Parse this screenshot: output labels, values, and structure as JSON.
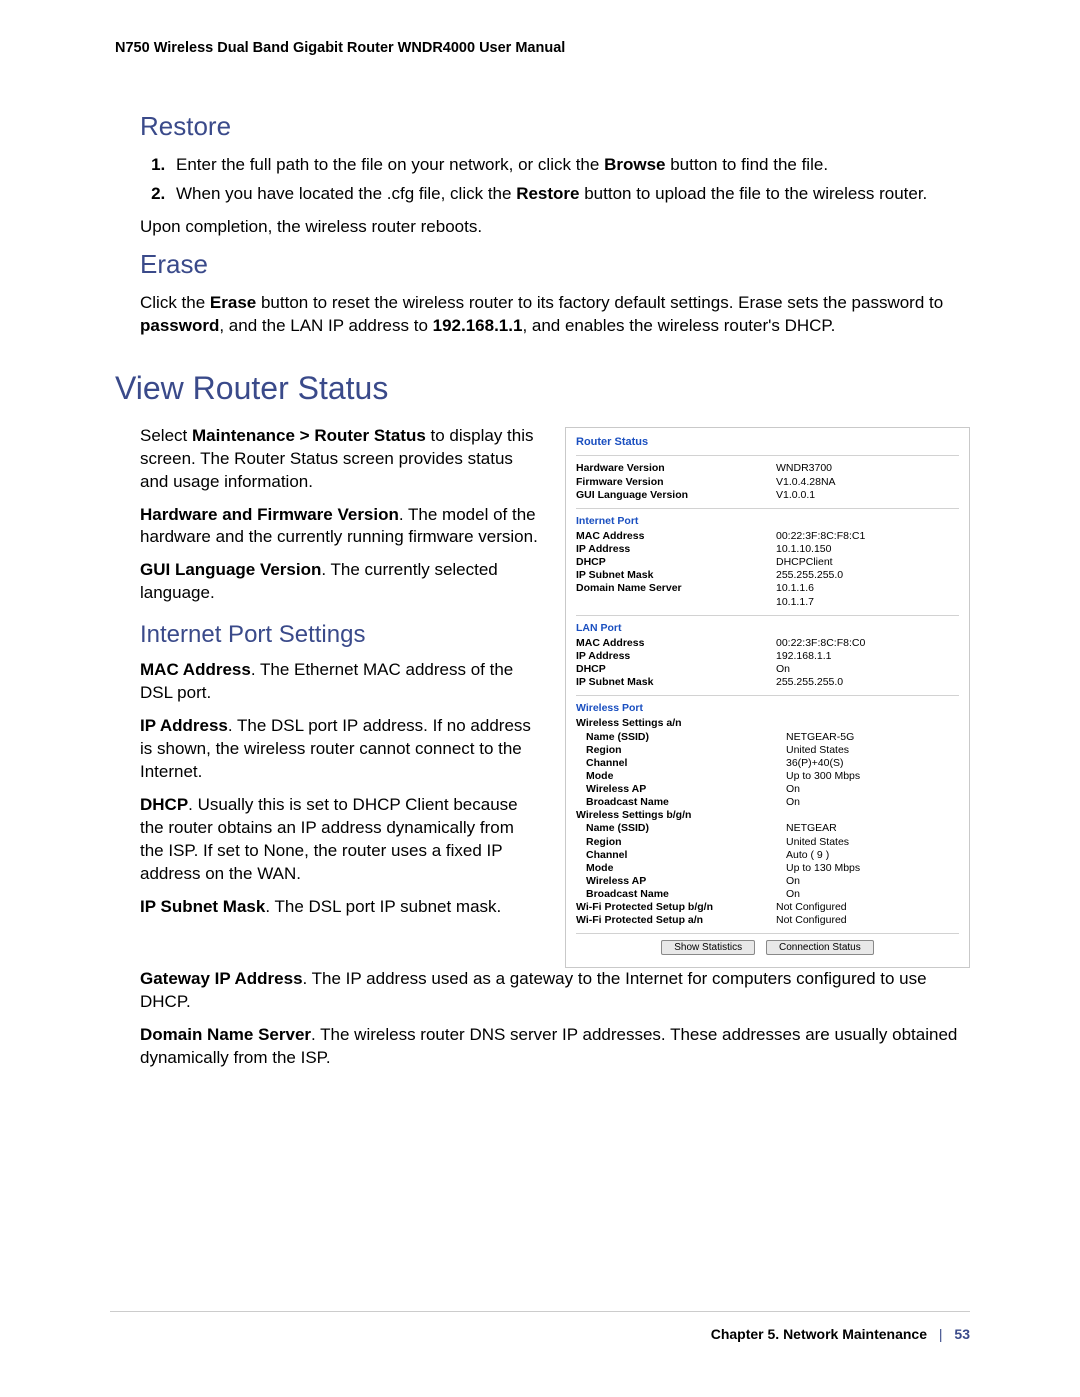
{
  "header": "N750 Wireless Dual Band Gigabit Router WNDR4000 User Manual",
  "restore": {
    "title": "Restore",
    "step1_a": "Enter the full path to the file on your network, or click the ",
    "step1_b": "Browse",
    "step1_c": " button to find the file.",
    "step2_a": "When you have located the .cfg file, click the ",
    "step2_b": "Restore",
    "step2_c": " button to upload the file to the wireless router.",
    "after": "Upon completion, the wireless router reboots."
  },
  "erase": {
    "title": "Erase",
    "p1_a": "Click the ",
    "p1_b": "Erase",
    "p1_c": " button to reset the wireless router to its factory default settings. Erase sets the password to ",
    "p1_d": "password",
    "p1_e": ", and the LAN IP address to ",
    "p1_f": "192.168.1.1",
    "p1_g": ", and enables the wireless router's DHCP."
  },
  "view": {
    "title": "View Router Status",
    "p1_a": "Select ",
    "p1_b": "Maintenance > Router Status",
    "p1_c": " to display this screen. The Router Status screen provides status and usage information.",
    "hw_a": "Hardware and Firmware Version",
    "hw_b": ". The model of the hardware and the currently running firmware version.",
    "gui_a": "GUI Language Version",
    "gui_b": ". The currently selected language.",
    "ip_title": "Internet Port Settings",
    "mac_a": "MAC Address",
    "mac_b": ". The Ethernet MAC address of the DSL port.",
    "ipaddr_a": "IP Address",
    "ipaddr_b": ". The DSL port IP address. If no address is shown, the wireless router cannot connect to the Internet.",
    "dhcp_a": "DHCP",
    "dhcp_b": ". Usually this is set to DHCP Client because the router obtains an IP address dynamically from the ISP. If set to None, the router uses a fixed IP address on the WAN.",
    "mask_a": "IP Subnet Mask",
    "mask_b": ". The DSL port IP subnet mask.",
    "gw_a": "Gateway IP Address",
    "gw_b": ". The IP address used as a gateway to the Internet for computers configured to use DHCP.",
    "dns_a": "Domain Name Server",
    "dns_b": ". The wireless router DNS server IP addresses. These addresses are usually obtained dynamically from the ISP."
  },
  "panel": {
    "title": "Router Status",
    "top": {
      "hw_k": "Hardware Version",
      "hw_v": "WNDR3700",
      "fw_k": "Firmware Version",
      "fw_v": "V1.0.4.28NA",
      "gui_k": "GUI Language Version",
      "gui_v": "V1.0.0.1"
    },
    "inet": {
      "title": "Internet Port",
      "mac_k": "MAC Address",
      "mac_v": "00:22:3F:8C:F8:C1",
      "ip_k": "IP Address",
      "ip_v": "10.1.10.150",
      "dhcp_k": "DHCP",
      "dhcp_v": "DHCPClient",
      "mask_k": "IP Subnet Mask",
      "mask_v": "255.255.255.0",
      "dns_k": "Domain Name Server",
      "dns_v1": "10.1.1.6",
      "dns_v2": "10.1.1.7"
    },
    "lan": {
      "title": "LAN Port",
      "mac_k": "MAC Address",
      "mac_v": "00:22:3F:8C:F8:C0",
      "ip_k": "IP Address",
      "ip_v": "192.168.1.1",
      "dhcp_k": "DHCP",
      "dhcp_v": "On",
      "mask_k": "IP Subnet Mask",
      "mask_v": "255.255.255.0"
    },
    "wlan": {
      "title": "Wireless Port",
      "an_head": "Wireless Settings a/n",
      "ssid_k": "Name (SSID)",
      "an_ssid": "NETGEAR-5G",
      "region_k": "Region",
      "an_region": "United States",
      "channel_k": "Channel",
      "an_channel": "36(P)+40(S)",
      "mode_k": "Mode",
      "an_mode": "Up to 300 Mbps",
      "ap_k": "Wireless AP",
      "an_ap": "On",
      "bcast_k": "Broadcast Name",
      "an_bcast": "On",
      "bgn_head": "Wireless Settings b/g/n",
      "bgn_ssid": "NETGEAR",
      "bgn_region": "United States",
      "bgn_channel": "Auto ( 9 )",
      "bgn_mode": "Up to 130 Mbps",
      "bgn_ap": "On",
      "bgn_bcast": "On",
      "wps_bgn_k": "Wi-Fi Protected Setup b/g/n",
      "wps_bgn_v": "Not Configured",
      "wps_an_k": "Wi-Fi Protected Setup a/n",
      "wps_an_v": "Not Configured"
    },
    "buttons": {
      "stats": "Show Statistics",
      "conn": "Connection Status"
    }
  },
  "footer": {
    "chapter": "Chapter 5.  Network Maintenance",
    "sep": "|",
    "page": "53"
  }
}
